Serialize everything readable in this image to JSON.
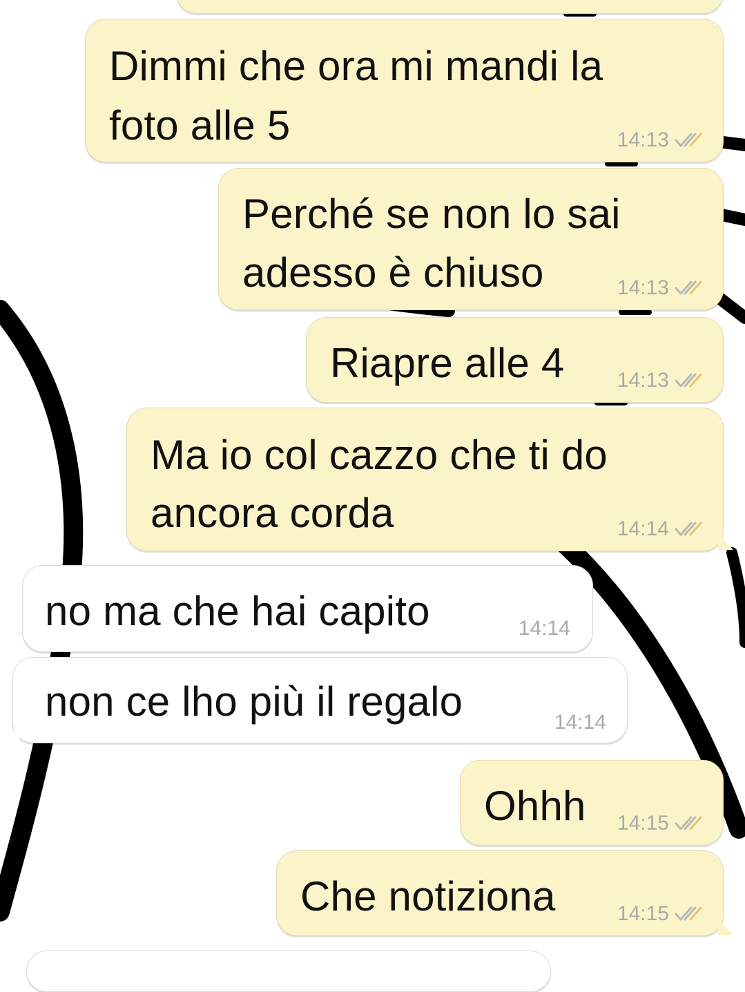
{
  "messages": [
    {
      "text_lines": [
        "Dimmi che ora mi mandi la",
        "foto alle 5"
      ],
      "time": "14:13",
      "direction": "sent",
      "ticks": "double-check-icon"
    },
    {
      "text_lines": [
        "Perché se non lo sai",
        "adesso è chiuso"
      ],
      "time": "14:13",
      "direction": "sent",
      "ticks": "double-check-icon"
    },
    {
      "text_lines": [
        "Riapre alle 4"
      ],
      "time": "14:13",
      "direction": "sent",
      "ticks": "double-check-icon"
    },
    {
      "text_lines": [
        "Ma io col cazzo che ti do",
        "ancora corda"
      ],
      "time": "14:14",
      "direction": "sent",
      "ticks": "double-check-icon"
    },
    {
      "text_lines": [
        "no ma che hai capito"
      ],
      "time": "14:14",
      "direction": "received"
    },
    {
      "text_lines": [
        "non ce lho più il regalo"
      ],
      "time": "14:14",
      "direction": "received"
    },
    {
      "text_lines": [
        "Ohhh"
      ],
      "time": "14:15",
      "direction": "sent",
      "ticks": "double-check-icon"
    },
    {
      "text_lines": [
        "Che notiziona"
      ],
      "time": "14:15",
      "direction": "sent",
      "ticks": "double-check-icon"
    }
  ],
  "colors": {
    "sent_bubble": "#fcf4c9",
    "received_bubble": "#ffffff",
    "text": "#111111",
    "meta": "#a9a9a9",
    "wallpaper_ink": "#000000"
  }
}
